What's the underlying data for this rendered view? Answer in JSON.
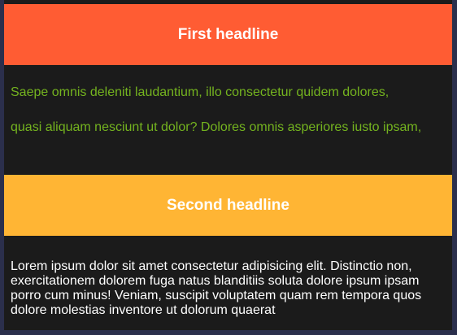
{
  "section1": {
    "headline": "First headline",
    "paragraphs": [
      "Saepe omnis deleniti laudantium, illo consectetur quidem dolores,",
      "quasi aliquam nesciunt ut dolor? Dolores omnis asperiores iusto ipsam,"
    ],
    "header_color": "#ff5c33",
    "text_color": "#74b31f"
  },
  "section2": {
    "headline": "Second headline",
    "paragraph": "Lorem ipsum dolor sit amet consectetur adipisicing elit. Distinctio non, exercitationem dolorem fuga natus blanditiis soluta dolore ipsum ipsam porro cum minus! Veniam, suscipit voluptatem quam rem tempora quos dolore molestias inventore ut dolorum quaerat",
    "header_color": "#ffb534"
  }
}
